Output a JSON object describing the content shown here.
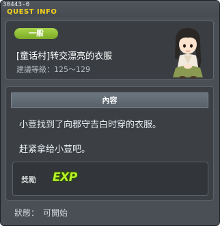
{
  "window": {
    "quest_id": "30443-0",
    "title": "QUEST INFO"
  },
  "header": {
    "category": "一般",
    "quest_name": "[童话村]转交漂亮的衣服",
    "level_range": "建議等級：125～129",
    "npc_icon": "npc-girl-portrait"
  },
  "content": {
    "heading": "內容",
    "lines": [
      "小荳找到了向郡守吉白时穿的衣服。",
      "赶紧拿给小荳吧。"
    ]
  },
  "reward": {
    "label": "獎勵",
    "exp_label": "EXP",
    "exp_icon": "exp-icon"
  },
  "status": {
    "label": "狀態：",
    "value": "可開始"
  },
  "colors": {
    "title_accent": "#f4d21b",
    "badge_green": "#8dbf32",
    "window_bg": "#4a4f55"
  }
}
